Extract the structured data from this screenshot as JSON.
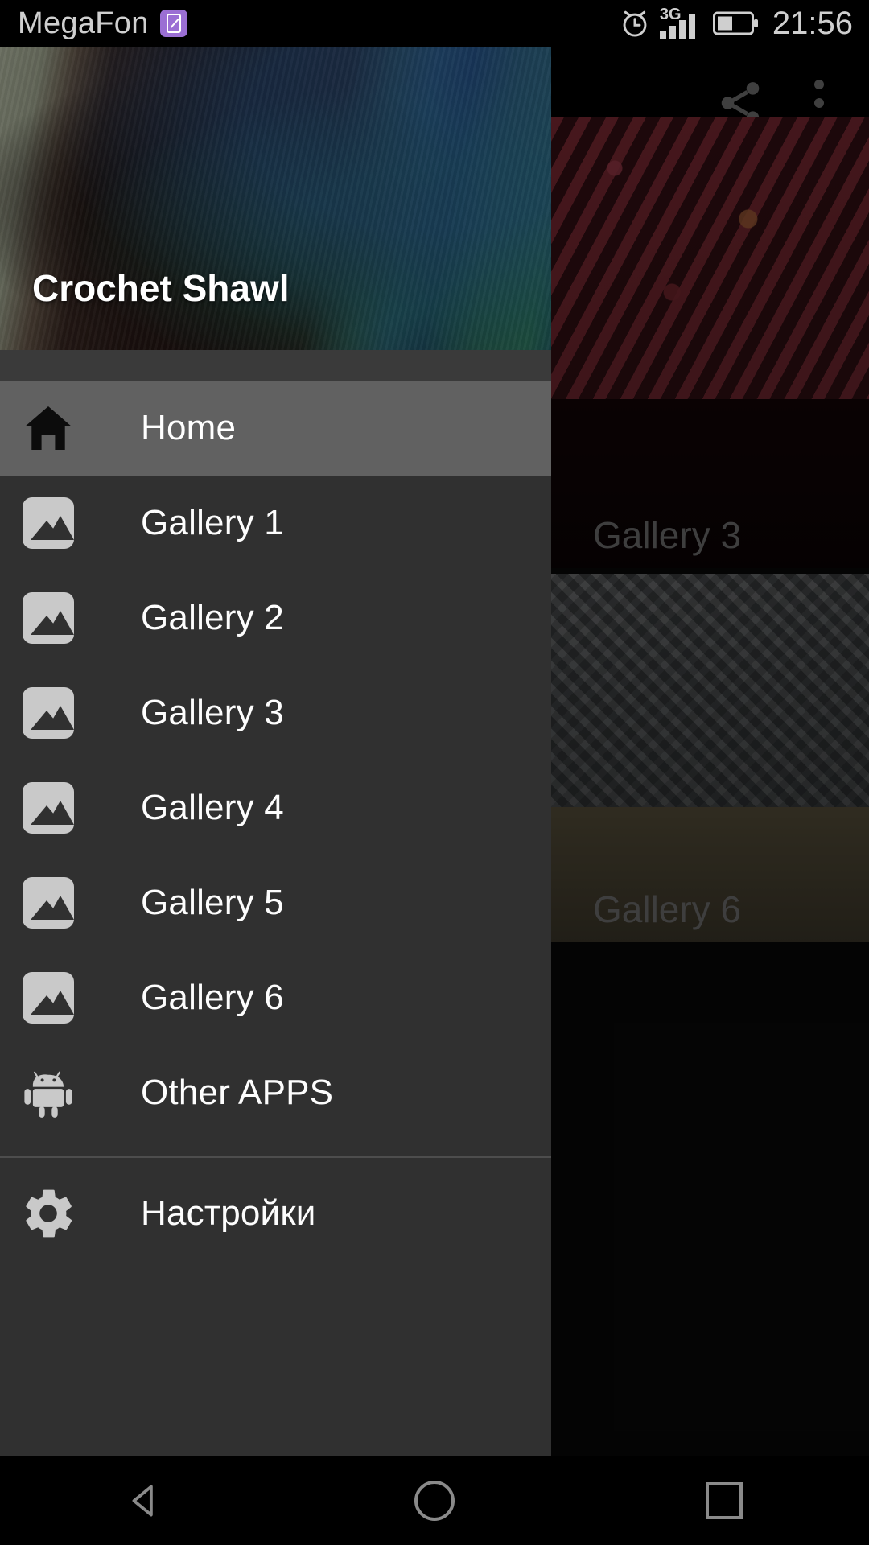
{
  "status_bar": {
    "carrier": "MegaFon",
    "sim_icon": "sim-card-icon",
    "alarm_icon": "alarm-clock-icon",
    "network_type": "3G",
    "signal_icon": "signal-bars-icon",
    "battery_icon": "battery-half-icon",
    "time": "21:56"
  },
  "app_bar": {
    "share_label": "share-icon",
    "overflow_label": "overflow-menu-icon"
  },
  "drawer": {
    "title": "Crochet Shawl",
    "items": [
      {
        "label": "Home",
        "icon": "home-icon",
        "selected": true
      },
      {
        "label": "Gallery 1",
        "icon": "image-icon",
        "selected": false
      },
      {
        "label": "Gallery 2",
        "icon": "image-icon",
        "selected": false
      },
      {
        "label": "Gallery 3",
        "icon": "image-icon",
        "selected": false
      },
      {
        "label": "Gallery 4",
        "icon": "image-icon",
        "selected": false
      },
      {
        "label": "Gallery 5",
        "icon": "image-icon",
        "selected": false
      },
      {
        "label": "Gallery 6",
        "icon": "image-icon",
        "selected": false
      },
      {
        "label": "Other APPS",
        "icon": "android-robot-icon",
        "selected": false
      }
    ],
    "footer_items": [
      {
        "label": "Настройки",
        "icon": "gear-icon"
      }
    ]
  },
  "content": {
    "cards": [
      {
        "caption": "Gallery 3"
      },
      {
        "caption": "Gallery 6"
      }
    ]
  },
  "nav_bar": {
    "back": "back-icon",
    "home": "home-circle-icon",
    "recents": "recents-square-icon"
  },
  "colors": {
    "drawer_bg": "#303030",
    "selected_row": "#616161",
    "text": "#fdfdfd",
    "icon_gray": "#c9c9c9",
    "status_text": "#cfcfcf",
    "sim_badge": "#9b6fd4"
  }
}
